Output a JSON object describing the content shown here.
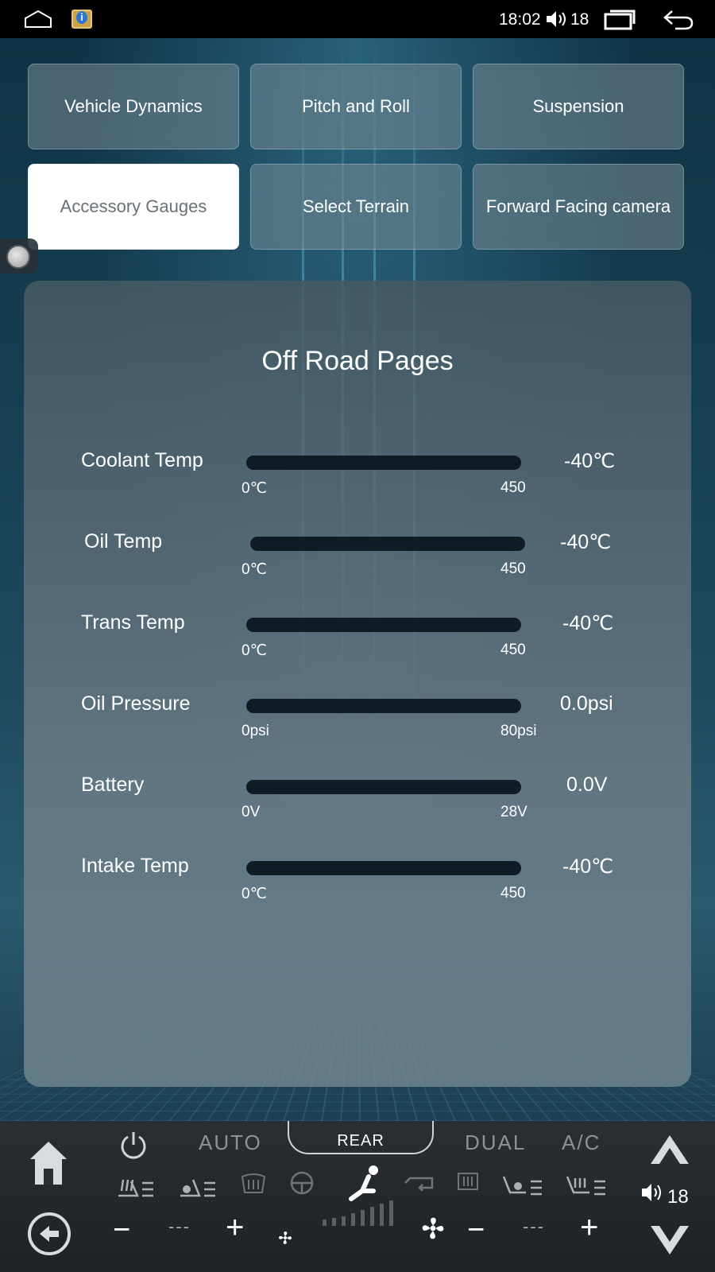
{
  "status_bar": {
    "time": "18:02",
    "volume": "18"
  },
  "menu": {
    "buttons": [
      {
        "label": "Vehicle Dynamics",
        "active": false
      },
      {
        "label": "Pitch and Roll",
        "active": false
      },
      {
        "label": "Suspension",
        "active": false
      },
      {
        "label": "Accessory Gauges",
        "active": true
      },
      {
        "label": "Select Terrain",
        "active": false
      },
      {
        "label": "Forward Facing camera",
        "active": false
      }
    ]
  },
  "panel": {
    "title": "Off Road Pages",
    "gauges": [
      {
        "label": "Coolant Temp",
        "min": "0℃",
        "max": "450",
        "value": "-40℃",
        "fill": 0
      },
      {
        "label": "Oil Temp",
        "min": "0℃",
        "max": "450",
        "value": "-40℃",
        "fill": 0
      },
      {
        "label": "Trans Temp",
        "min": "0℃",
        "max": "450",
        "value": "-40℃",
        "fill": 0
      },
      {
        "label": "Oil Pressure",
        "min": "0psi",
        "max": "80psi",
        "value": "0.0psi",
        "fill": 0
      },
      {
        "label": "Battery",
        "min": "0V",
        "max": "28V",
        "value": "0.0V",
        "fill": 0
      },
      {
        "label": "Intake Temp",
        "min": "0℃",
        "max": "450",
        "value": "-40℃",
        "fill": 0
      }
    ]
  },
  "climate": {
    "auto_label": "AUTO",
    "rear_label": "REAR",
    "dual_label": "DUAL",
    "ac_label": "A/C",
    "left_temp": "---",
    "right_temp": "---",
    "volume": "18",
    "minus": "−",
    "plus": "+"
  },
  "colors": {
    "active_button_bg": "#ffffff",
    "active_button_text": "#6b7276",
    "gauge_track": "#0f1c25"
  }
}
